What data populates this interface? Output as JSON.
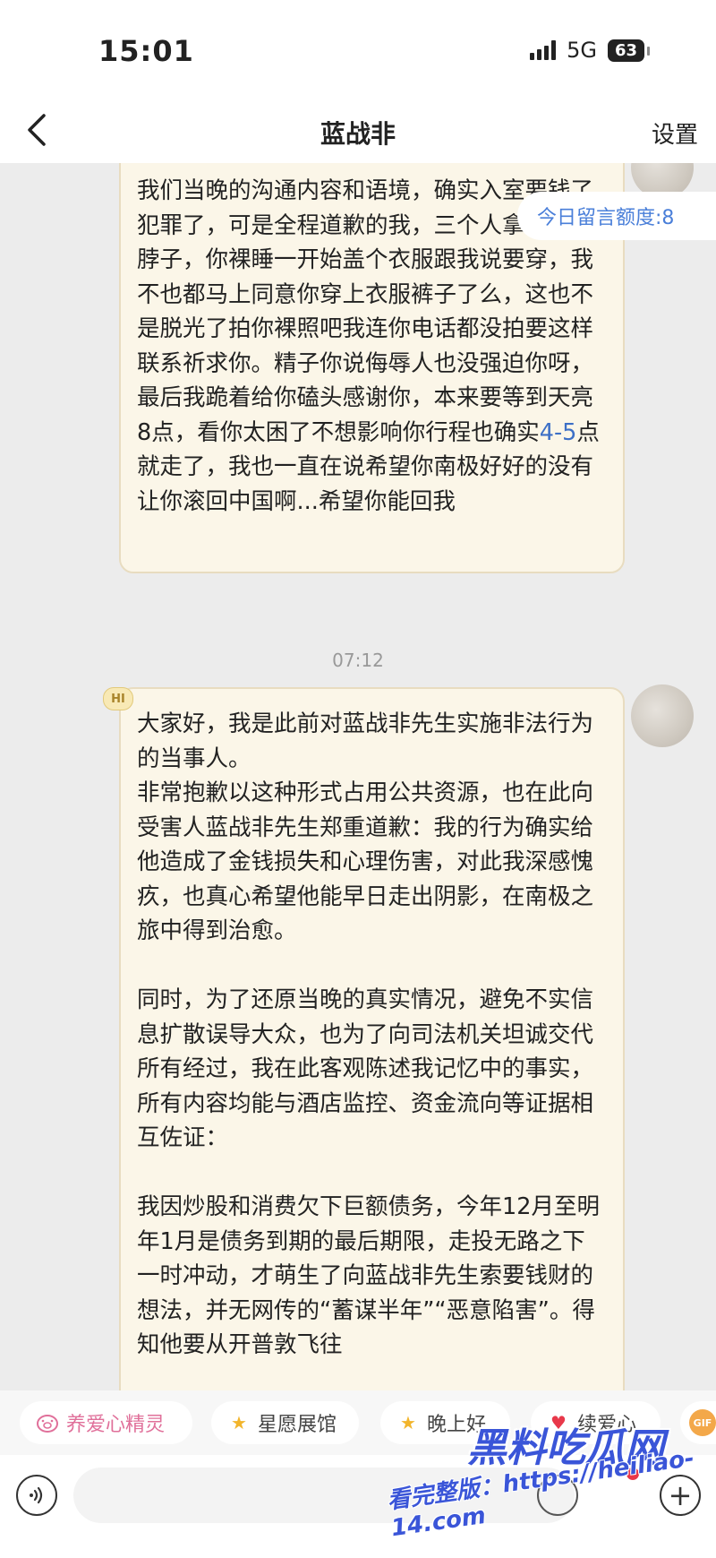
{
  "status": {
    "time": "15:01",
    "network": "5G",
    "battery": "63"
  },
  "nav": {
    "title": "蓝战非",
    "settings_label": "设置"
  },
  "quota": {
    "label": "今日留言额度:8"
  },
  "messages": [
    {
      "sender": "self",
      "text_before": "我们当晚的沟通内容和语境，确实入室要钱了犯罪了，可是全程道歉的我，三个人拿刀架你脖子，你裸睡一开始盖个衣服跟我说要穿，我不也都马上同意你穿上衣服裤子了么，这也不是脱光了拍你裸照吧我连你电话都没拍要这样联系祈求你。精子你说侮辱人也没强迫你呀，最后我跪着给你磕头感谢你，本来要等到天亮8点，看你太困了不想影响你行程也确实",
      "text_highlight": "4-5",
      "text_after": "点就走了，我也一直在说希望你南极好好的没有让你滚回中国啊...希望你能回我"
    },
    {
      "sender": "self",
      "badge": "HI",
      "text": "大家好，我是此前对蓝战非先生实施非法行为的当事人。\n非常抱歉以这种形式占用公共资源，也在此向受害人蓝战非先生郑重道歉：我的行为确实给他造成了金钱损失和心理伤害，对此我深感愧疚，也真心希望他能早日走出阴影，在南极之旅中得到治愈。\n\n同时，为了还原当晚的真实情况，避免不实信息扩散误导大众，也为了向司法机关坦诚交代所有经过，我在此客观陈述我记忆中的事实，所有内容均能与酒店监控、资金流向等证据相互佐证：\n\n我因炒股和消费欠下巨额债务，今年12月至明年1月是债务到期的最后期限，走投无路之下一时冲动，才萌生了向蓝战非先生索要钱财的想法，并无网传的“蓄谋半年”“恶意陷害”。得知他要从开普敦飞往"
    }
  ],
  "timestamp": "07:12",
  "quick_actions": [
    {
      "label": "养爱心精灵",
      "icon": "pig-icon"
    },
    {
      "label": "星愿展馆",
      "icon": "star-face-icon"
    },
    {
      "label": "晚上好",
      "icon": "star-icon"
    },
    {
      "label": "续爱心",
      "icon": "heart-icon"
    },
    {
      "label": "GIF",
      "icon": "gif-icon"
    }
  ],
  "input": {
    "placeholder": ""
  },
  "watermark": {
    "brand": "黑料吃瓜网",
    "url": "看完整版：https://heiliao-14.com"
  },
  "colors": {
    "bubble_bg": "#fbf6e8",
    "accent_blue": "#4a7fd9",
    "background": "#ececec"
  }
}
